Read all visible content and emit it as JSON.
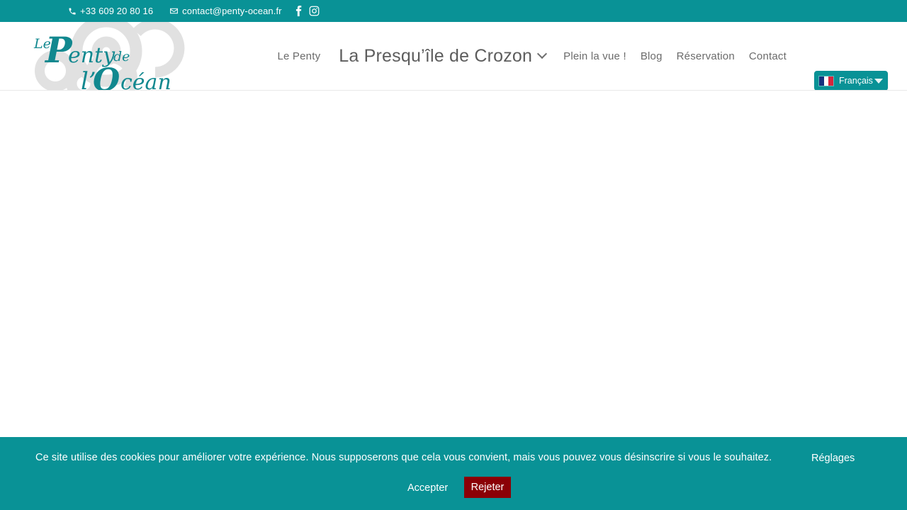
{
  "colors": {
    "brand_teal": "#099296",
    "logo_teal": "#11888f",
    "swirl_gray": "#e0e0e0",
    "nav_text": "#6b6b6b",
    "reject_red": "#8b0006",
    "page_background": "#ffffff"
  },
  "topbar": {
    "phone": "+33 609 20 80 16",
    "email": "contact@penty-ocean.fr",
    "phone_icon": "phone-icon",
    "email_icon": "envelope-icon",
    "social": [
      {
        "name": "facebook-icon",
        "label": "Facebook"
      },
      {
        "name": "instagram-icon",
        "label": "Instagram"
      }
    ]
  },
  "header": {
    "logo": {
      "line1_a": "Le",
      "line1_b": "Penty",
      "line1_c": "de",
      "line2": "l’Océan",
      "alt": "Le Penty de l’Océan"
    },
    "nav": [
      {
        "label": "Le Penty",
        "name": "nav-le-penty",
        "active": false,
        "has_dropdown": false
      },
      {
        "label": "La Presqu’île de Crozon",
        "name": "nav-presquile-crozon",
        "active": true,
        "has_dropdown": true
      },
      {
        "label": "Plein la vue !",
        "name": "nav-plein-la-vue",
        "active": false,
        "has_dropdown": false
      },
      {
        "label": "Blog",
        "name": "nav-blog",
        "active": false,
        "has_dropdown": false
      },
      {
        "label": "Réservation",
        "name": "nav-reservation",
        "active": false,
        "has_dropdown": false
      },
      {
        "label": "Contact",
        "name": "nav-contact",
        "active": false,
        "has_dropdown": false
      }
    ],
    "language": {
      "selected": "Français",
      "flag": "flag-france-icon",
      "caret": "chevron-down-icon"
    }
  },
  "cookie_banner": {
    "message": "Ce site utilise des cookies pour améliorer votre expérience. Nous supposerons que cela vous convient, mais vous pouvez vous désinscrire si vous le souhaitez.",
    "settings_label": "Réglages",
    "accept_label": "Accepter",
    "reject_label": "Rejeter"
  }
}
